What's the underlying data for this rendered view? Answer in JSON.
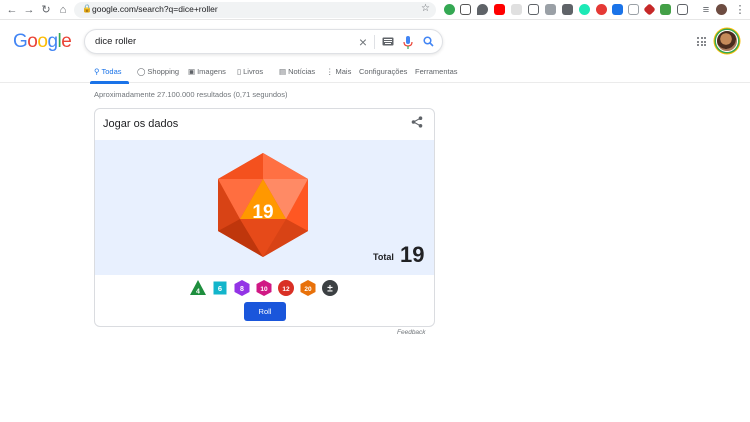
{
  "browser": {
    "url": "google.com/search?q=dice+roller"
  },
  "search": {
    "query": "dice roller"
  },
  "logo": {
    "letters": [
      "G",
      "o",
      "o",
      "g",
      "l",
      "e"
    ],
    "colors": [
      "#4285F4",
      "#EA4335",
      "#FBBC05",
      "#4285F4",
      "#34A853",
      "#EA4335"
    ]
  },
  "tabs": [
    {
      "label": "Todas",
      "icon": "search-icon",
      "active": true
    },
    {
      "label": "Shopping",
      "icon": "tag-icon",
      "active": false
    },
    {
      "label": "Imagens",
      "icon": "image-icon",
      "active": false
    },
    {
      "label": "Livros",
      "icon": "book-icon",
      "active": false
    },
    {
      "label": "Notícias",
      "icon": "news-icon",
      "active": false
    },
    {
      "label": "Mais",
      "icon": "more-vert-icon",
      "active": false
    },
    {
      "label": "Configurações",
      "active": false
    },
    {
      "label": "Ferramentas",
      "active": false
    }
  ],
  "results_stats": "Aproximadamente 27.100.000 resultados (0,71 segundos)",
  "dice_card": {
    "title": "Jogar os dados",
    "rolled_value": "19",
    "total_label": "Total",
    "total_value": "19",
    "dice_options": [
      {
        "label": "4",
        "shape": "triangle",
        "color": "#1e8e3e"
      },
      {
        "label": "6",
        "shape": "square",
        "color": "#12b5cb"
      },
      {
        "label": "8",
        "shape": "hexagon",
        "color": "#9334e6"
      },
      {
        "label": "10",
        "shape": "hexagon",
        "color": "#d01884"
      },
      {
        "label": "12",
        "shape": "circle",
        "color": "#d93025"
      },
      {
        "label": "20",
        "shape": "hexagon",
        "color": "#e8710a"
      },
      {
        "label": "±",
        "shape": "circle",
        "color": "#3c4043"
      }
    ],
    "roll_label": "Roll",
    "feedback_label": "Feedback"
  },
  "colors": {
    "accent": "#1a73e8",
    "roll_button": "#1a56db",
    "die_orange": "#f4511e"
  }
}
